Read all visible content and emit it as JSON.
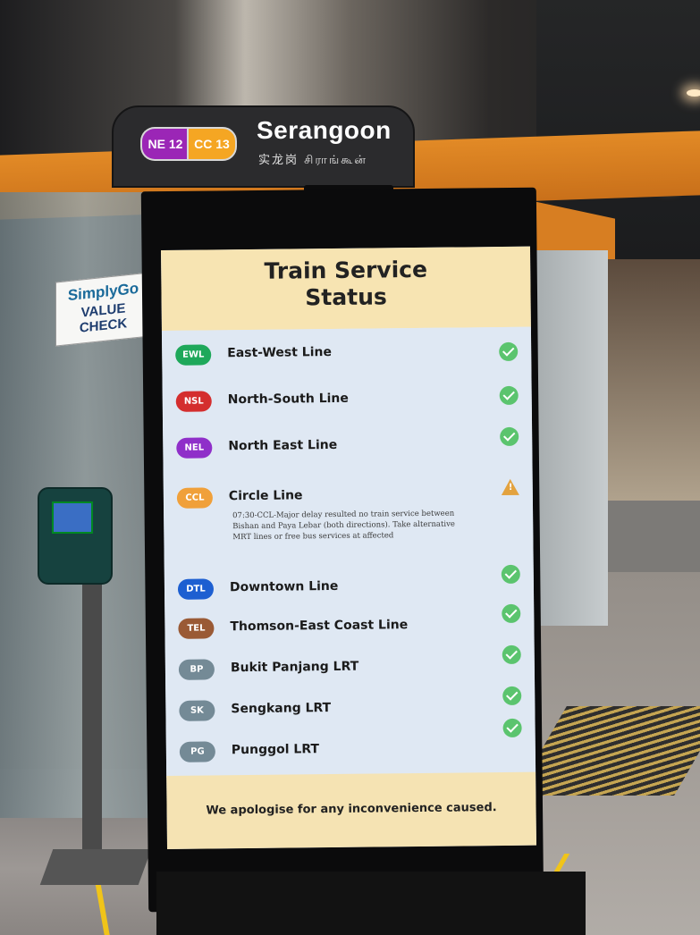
{
  "station": {
    "codes": [
      "NE 12",
      "CC 13"
    ],
    "name": "Serangoon",
    "name_sub": "实龙岗 சிராங்கூன்"
  },
  "simplygo_sign": {
    "line1": "SimplyGo",
    "line2": "VALUE CHECK"
  },
  "kiosk": {
    "title": "Train Service Status",
    "lines": [
      {
        "badge": "EWL",
        "name": "East-West Line",
        "status": "ok",
        "color": "#1ea85a"
      },
      {
        "badge": "NSL",
        "name": "North-South Line",
        "status": "ok",
        "color": "#d42e2e"
      },
      {
        "badge": "NEL",
        "name": "North East Line",
        "status": "ok",
        "color": "#8f2fc9"
      },
      {
        "badge": "CCL",
        "name": "Circle Line",
        "status": "warning",
        "color": "#f0a03a",
        "message": "07:30-CCL-Major delay resulted no train service between Bishan and Paya Lebar (both directions). Take alternative MRT lines or free bus services at affected"
      },
      {
        "badge": "DTL",
        "name": "Downtown Line",
        "status": "ok",
        "color": "#1d5fd1"
      },
      {
        "badge": "TEL",
        "name": "Thomson-East Coast Line",
        "status": "ok",
        "color": "#9a5a35"
      },
      {
        "badge": "BP",
        "name": "Bukit Panjang LRT",
        "status": "ok",
        "color": "#748a96"
      },
      {
        "badge": "SK",
        "name": "Sengkang LRT",
        "status": "ok",
        "color": "#748a96"
      },
      {
        "badge": "PG",
        "name": "Punggol LRT",
        "status": "ok",
        "color": "#748a96"
      }
    ],
    "footer": "We apologise for any inconvenience caused."
  }
}
